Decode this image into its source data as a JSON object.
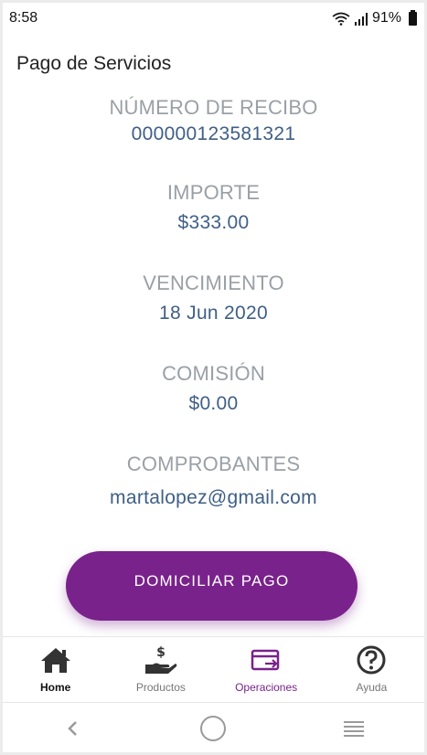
{
  "status_bar": {
    "time": "8:58",
    "battery": "91%"
  },
  "header": {
    "title": "Pago de Servicios"
  },
  "fields": [
    {
      "label": "NÚMERO DE RECIBO",
      "value": "000000123581321"
    },
    {
      "label": "IMPORTE",
      "value": "$333.00"
    },
    {
      "label": "VENCIMIENTO",
      "value": "18 Jun 2020"
    },
    {
      "label": "COMISIÓN",
      "value": "$0.00"
    },
    {
      "label": "COMPROBANTES",
      "value": "martalopez@gmail.com"
    }
  ],
  "action": {
    "label": "DOMICILIAR PAGO"
  },
  "bottom_nav": {
    "items": [
      {
        "label": "Home",
        "icon": "home-icon"
      },
      {
        "label": "Productos",
        "icon": "hand-dollar-icon"
      },
      {
        "label": "Operaciones",
        "icon": "card-transfer-icon"
      },
      {
        "label": "Ayuda",
        "icon": "help-icon"
      }
    ]
  },
  "colors": {
    "accent": "#79228b",
    "value_text": "#3f5f86",
    "label_text": "#9aa0a6"
  }
}
